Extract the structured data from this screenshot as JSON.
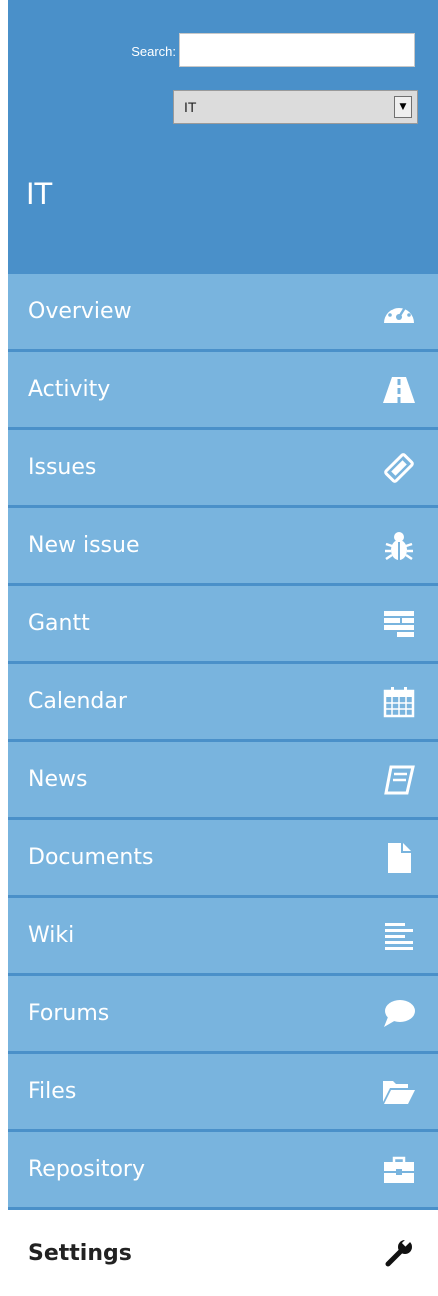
{
  "search": {
    "label": "Search:",
    "value": ""
  },
  "project_select": {
    "selected": "IT"
  },
  "project": {
    "title": "IT"
  },
  "menu": [
    {
      "label": "Overview",
      "icon": "dashboard-icon"
    },
    {
      "label": "Activity",
      "icon": "road-icon"
    },
    {
      "label": "Issues",
      "icon": "ticket-icon"
    },
    {
      "label": "New issue",
      "icon": "bug-icon"
    },
    {
      "label": "Gantt",
      "icon": "gantt-icon"
    },
    {
      "label": "Calendar",
      "icon": "calendar-icon"
    },
    {
      "label": "News",
      "icon": "book-icon"
    },
    {
      "label": "Documents",
      "icon": "document-icon"
    },
    {
      "label": "Wiki",
      "icon": "align-left-icon"
    },
    {
      "label": "Forums",
      "icon": "speech-bubble-icon"
    },
    {
      "label": "Files",
      "icon": "folder-open-icon"
    },
    {
      "label": "Repository",
      "icon": "briefcase-icon"
    },
    {
      "label": "Settings",
      "icon": "wrench-icon",
      "selected": true
    }
  ],
  "colors": {
    "header_bg": "#4a90c9",
    "item_bg": "#79b4de",
    "selected_bg": "#ffffff"
  }
}
